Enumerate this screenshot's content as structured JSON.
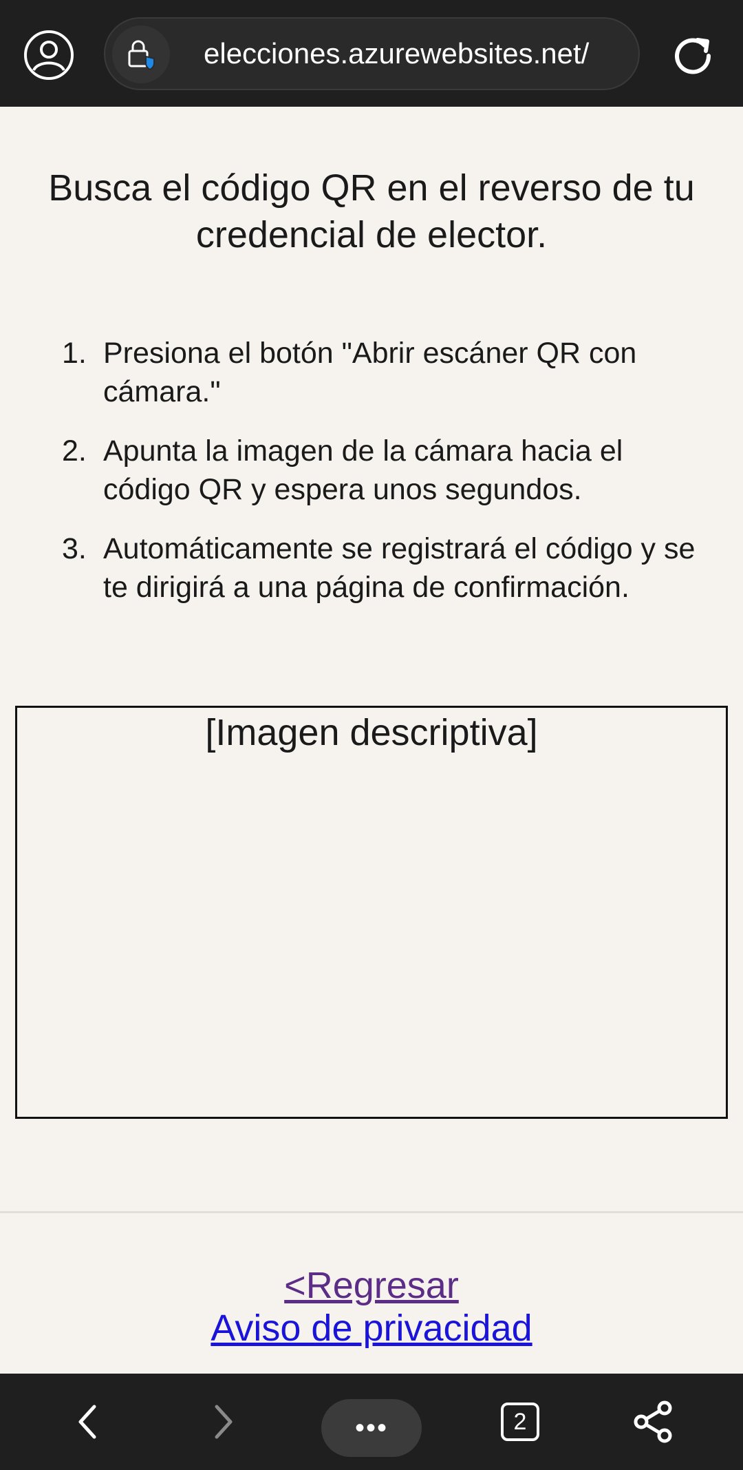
{
  "browser": {
    "url": "elecciones.azurewebsites.net/",
    "tab_count": "2",
    "menu_label": "•••"
  },
  "page": {
    "title": "Busca el código QR en el reverso de tu credencial de elector.",
    "steps": [
      {
        "number": "1.",
        "text": "Presiona el botón \"Abrir escáner QR con cámara.\""
      },
      {
        "number": "2.",
        "text": "Apunta la imagen de la cámara hacia el código QR y espera unos segundos."
      },
      {
        "number": "3.",
        "text": "Automáticamente se registrará el código y se te dirigirá a una página de confirmación."
      }
    ],
    "image_placeholder": "[Imagen descriptiva]",
    "links": {
      "back": "<Regresar",
      "privacy": "Aviso de privacidad"
    }
  },
  "icons": {
    "profile": "user-circle-icon",
    "site_security": "lock-shield-icon",
    "reload": "reload-icon",
    "back": "chevron-left-icon",
    "forward": "chevron-right-icon",
    "share": "share-icon"
  },
  "colors": {
    "browser_chrome": "#1f1f1f",
    "page_background": "#f6f3ef",
    "visited_link": "#5b2d86",
    "link": "#1a14d8",
    "shield_accent": "#1e88e5"
  }
}
